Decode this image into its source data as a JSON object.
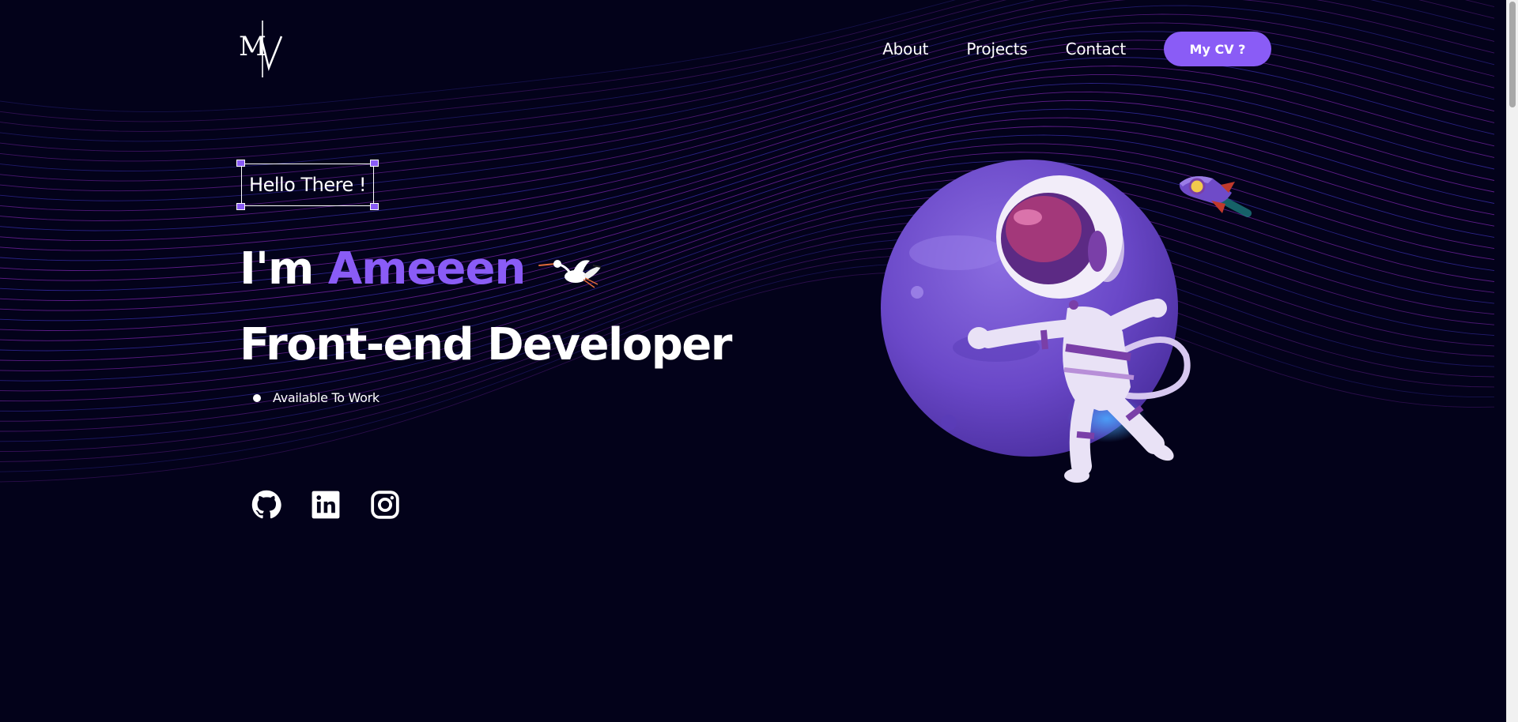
{
  "header": {
    "logo_text": "MV",
    "nav": [
      {
        "label": "About"
      },
      {
        "label": "Projects"
      },
      {
        "label": "Contact"
      }
    ],
    "cv_button": "My CV ?"
  },
  "hero": {
    "greeting": "Hello There !",
    "intro_prefix": "I'm",
    "name": "Ameeen",
    "role": "Front-end Developer",
    "status": "Available To Work"
  },
  "socials": [
    {
      "icon": "github-icon"
    },
    {
      "icon": "linkedin-icon"
    },
    {
      "icon": "instagram-icon"
    }
  ],
  "colors": {
    "background": "#03021a",
    "accent": "#8a5cf6",
    "text": "#ffffff",
    "wave": "#9b2fd6"
  }
}
